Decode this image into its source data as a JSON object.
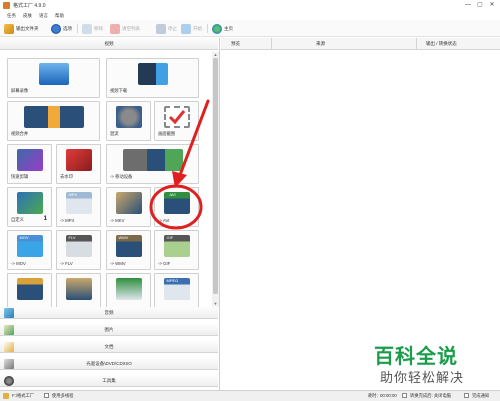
{
  "window": {
    "title": "格式工厂 4.9.0",
    "controls": [
      "—",
      "▢",
      "✕"
    ]
  },
  "menu": [
    "任务",
    "皮肤",
    "语言",
    "帮助"
  ],
  "toolbar": {
    "output_folder": "输出文件夹",
    "options": "选项",
    "remove": "移除",
    "clear_list": "清空列表",
    "stop": "停止",
    "start": "开始",
    "homepage": "主页"
  },
  "categories": {
    "video": "视频",
    "audio": "音频",
    "picture": "图片",
    "document": "文档",
    "disc": "光驱设备\\DVD\\CD\\ISO",
    "toolbox": "工具集"
  },
  "tiles": {
    "screen_record": "屏幕录像",
    "video_download": "视频下载",
    "video_merge": "视频合并",
    "mix": "混流",
    "watermark": "画面截图",
    "quick_clip": "快速剪辑",
    "gif_clip": "去水印",
    "to_mobile": "-> 移动设备",
    "custom": "自定义",
    "custom_count": "1",
    "to_mp4": "-> MP4",
    "to_mkv": "-> MKV",
    "to_avi": "-> AVI",
    "to_mov": "-> MOV",
    "to_flv": "-> FLV",
    "to_wmv": "-> WMV",
    "to_gif": "-> GIF"
  },
  "tile_badges": {
    "mp4": "MP4",
    "mov": "MOV",
    "flv": "FLV",
    "wmv": "WMV",
    "gif": "GIF",
    "avi": "AVI",
    "mpeg": "MPEG"
  },
  "table": {
    "col_preview": "预览",
    "col_source": "来源",
    "col_output": "输出 / 转换状态"
  },
  "status": {
    "output_folder": "F:\\格式工厂",
    "multithread": "使用多线程",
    "elapsed_label": "耗时:",
    "elapsed": "00:00:00",
    "shutdown_after": "转换完成后: 关闭电脑",
    "notify": "完成通知"
  },
  "watermark": {
    "line1": "百科全说",
    "line2": "助你轻松解决"
  },
  "colors": {
    "annotation_red": "#e02020",
    "brand_green": "#1a9d4b"
  }
}
